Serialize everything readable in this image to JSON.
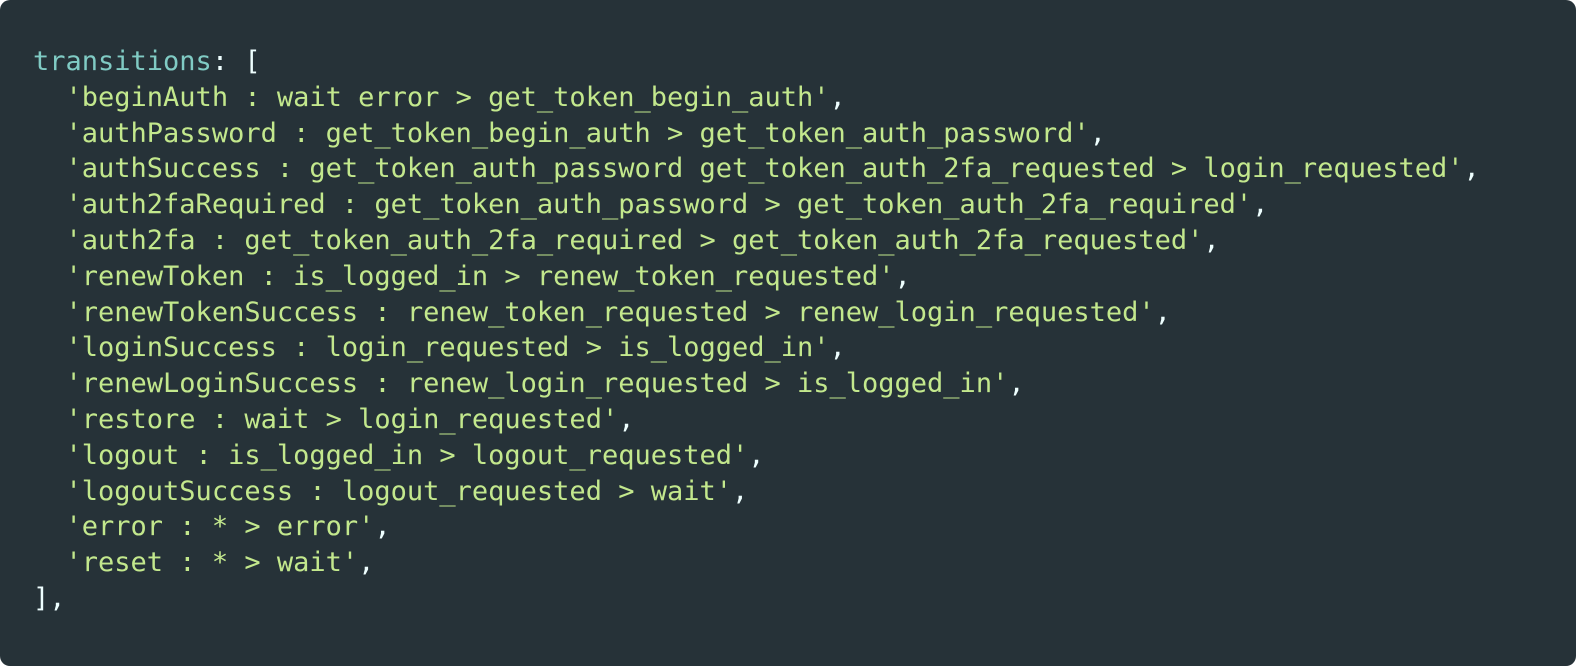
{
  "code": {
    "key": "transitions",
    "open_suffix": ": [",
    "indent": "  ",
    "entries": [
      {
        "text": "'beginAuth : wait error > get_token_begin_auth'",
        "sep": ","
      },
      {
        "text": "'authPassword : get_token_begin_auth > get_token_auth_password'",
        "sep": ","
      },
      {
        "text": "'authSuccess : get_token_auth_password get_token_auth_2fa_requested > login_requested'",
        "sep": ","
      },
      {
        "text": "'auth2faRequired : get_token_auth_password > get_token_auth_2fa_required'",
        "sep": ","
      },
      {
        "text": "'auth2fa : get_token_auth_2fa_required > get_token_auth_2fa_requested'",
        "sep": ","
      },
      {
        "text": "'renewToken : is_logged_in > renew_token_requested'",
        "sep": ","
      },
      {
        "text": "'renewTokenSuccess : renew_token_requested > renew_login_requested'",
        "sep": ","
      },
      {
        "text": "'loginSuccess : login_requested > is_logged_in'",
        "sep": ","
      },
      {
        "text": "'renewLoginSuccess : renew_login_requested > is_logged_in'",
        "sep": ","
      },
      {
        "text": "'restore : wait > login_requested'",
        "sep": ","
      },
      {
        "text": "'logout : is_logged_in > logout_requested'",
        "sep": ","
      },
      {
        "text": "'logoutSuccess : logout_requested > wait'",
        "sep": ","
      },
      {
        "text": "'error : * > error'",
        "sep": ","
      },
      {
        "text": "'reset : * > wait'",
        "sep": ","
      }
    ],
    "close": "],"
  },
  "colors": {
    "background": "#263238",
    "key": "#80cbc4",
    "punctuation": "#eeffff",
    "string": "#c3e88d"
  }
}
